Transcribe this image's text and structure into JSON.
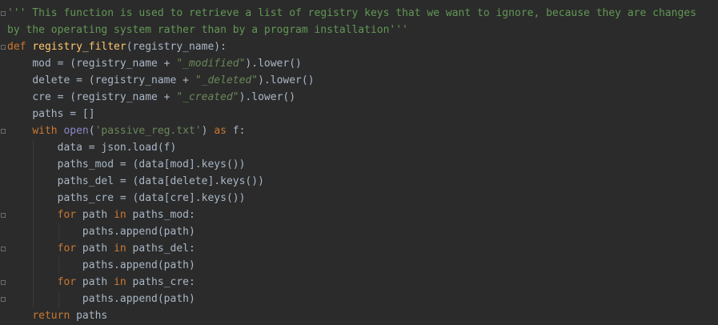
{
  "editor": {
    "colors": {
      "background": "#2b2b2b",
      "text": "#a9b7c6",
      "keyword": "#cc7832",
      "function": "#ffc66d",
      "string": "#6a8759",
      "docstring": "#629755",
      "builtin": "#8888c6"
    },
    "lines": [
      {
        "indent": "",
        "tokens": [
          {
            "t": "''' This function is used to retrieve a list of registry keys that we want to ignore, because they are changes",
            "c": "doc"
          }
        ]
      },
      {
        "indent": "",
        "tokens": [
          {
            "t": "by the operating system rather than by a program installation'''",
            "c": "doc"
          }
        ]
      },
      {
        "indent": "",
        "tokens": [
          {
            "t": "def",
            "c": "kw"
          },
          {
            "t": " ",
            "c": "plain"
          },
          {
            "t": "registry_filter",
            "c": "fn"
          },
          {
            "t": "(registry_name):",
            "c": "plain"
          }
        ]
      },
      {
        "indent": "    ",
        "tokens": [
          {
            "t": "mod = (registry_name + ",
            "c": "plain"
          },
          {
            "t": "\"_modified\"",
            "c": "str-i"
          },
          {
            "t": ").lower()",
            "c": "plain"
          }
        ]
      },
      {
        "indent": "    ",
        "tokens": [
          {
            "t": "delete = (registry_name + ",
            "c": "plain"
          },
          {
            "t": "\"_deleted\"",
            "c": "str-i"
          },
          {
            "t": ").lower()",
            "c": "plain"
          }
        ]
      },
      {
        "indent": "    ",
        "tokens": [
          {
            "t": "cre = (registry_name + ",
            "c": "plain"
          },
          {
            "t": "\"_created\"",
            "c": "str-i"
          },
          {
            "t": ").lower()",
            "c": "plain"
          }
        ]
      },
      {
        "indent": "    ",
        "tokens": [
          {
            "t": "paths = []",
            "c": "plain"
          }
        ]
      },
      {
        "indent": "    ",
        "tokens": [
          {
            "t": "with",
            "c": "kw"
          },
          {
            "t": " ",
            "c": "plain"
          },
          {
            "t": "open",
            "c": "builtin"
          },
          {
            "t": "(",
            "c": "plain"
          },
          {
            "t": "'passive_reg.txt'",
            "c": "str"
          },
          {
            "t": ") ",
            "c": "plain"
          },
          {
            "t": "as",
            "c": "kw"
          },
          {
            "t": " f:",
            "c": "plain"
          }
        ]
      },
      {
        "indent": "        ",
        "tokens": [
          {
            "t": "data = json.load(f)",
            "c": "plain"
          }
        ]
      },
      {
        "indent": "        ",
        "tokens": [
          {
            "t": "paths_mod = (data[mod].keys())",
            "c": "plain"
          }
        ]
      },
      {
        "indent": "        ",
        "tokens": [
          {
            "t": "paths_del = (data[delete].keys())",
            "c": "plain"
          }
        ]
      },
      {
        "indent": "        ",
        "tokens": [
          {
            "t": "paths_cre = (data[cre].keys())",
            "c": "plain"
          }
        ]
      },
      {
        "indent": "        ",
        "tokens": [
          {
            "t": "for",
            "c": "kw"
          },
          {
            "t": " path ",
            "c": "plain"
          },
          {
            "t": "in",
            "c": "kw"
          },
          {
            "t": " paths_mod:",
            "c": "plain"
          }
        ]
      },
      {
        "indent": "            ",
        "tokens": [
          {
            "t": "paths.append(path)",
            "c": "plain"
          }
        ]
      },
      {
        "indent": "        ",
        "tokens": [
          {
            "t": "for",
            "c": "kw"
          },
          {
            "t": " path ",
            "c": "plain"
          },
          {
            "t": "in",
            "c": "kw"
          },
          {
            "t": " paths_del:",
            "c": "plain"
          }
        ]
      },
      {
        "indent": "            ",
        "tokens": [
          {
            "t": "paths.append(path)",
            "c": "plain"
          }
        ]
      },
      {
        "indent": "        ",
        "tokens": [
          {
            "t": "for",
            "c": "kw"
          },
          {
            "t": " path ",
            "c": "plain"
          },
          {
            "t": "in",
            "c": "kw"
          },
          {
            "t": " paths_cre:",
            "c": "plain"
          }
        ]
      },
      {
        "indent": "            ",
        "tokens": [
          {
            "t": "paths.append(path)",
            "c": "plain"
          }
        ]
      },
      {
        "indent": "    ",
        "tokens": [
          {
            "t": "return",
            "c": "kw"
          },
          {
            "t": " paths",
            "c": "plain"
          }
        ]
      }
    ]
  }
}
